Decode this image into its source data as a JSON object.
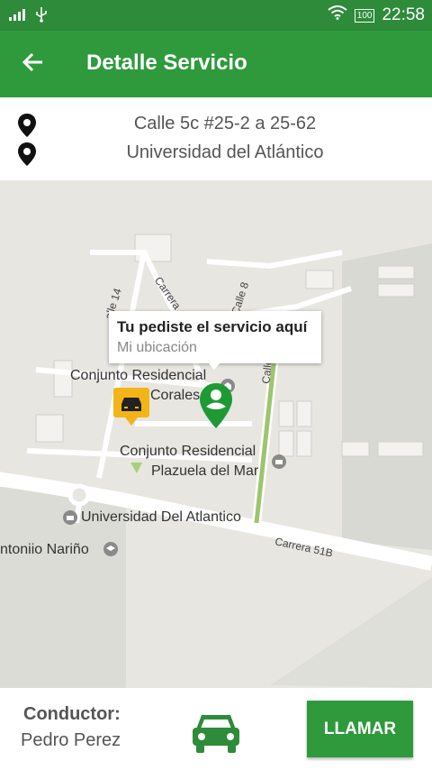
{
  "status_bar": {
    "battery": "100",
    "time": "22:58"
  },
  "app_bar": {
    "title": "Detalle Servicio"
  },
  "route": {
    "origin": "Calle 5c #25-2 a 25-62",
    "destination": "Universidad del Atlántico"
  },
  "map": {
    "info_window": {
      "title": "Tu pediste el servicio aquí",
      "subtitle": "Mi ubicación"
    },
    "labels": {
      "conjunto_corales_1": "Conjunto Residencial",
      "conjunto_corales_2": "Corales",
      "conjunto_plazuela_1": "Conjunto Residencial",
      "conjunto_plazuela_2": "Plazuela del Mar",
      "universidad": "Universidad Del Atlantico",
      "antonio": "ntoniio Nariño",
      "street_carrera_51b": "Carrera 51B",
      "street_calle_14": "alle 14",
      "street_carrera": "Carrera",
      "street_calle_8": "Calle 8",
      "street_calle": "Calle"
    }
  },
  "driver": {
    "label": "Conductor:",
    "name": "Pedro Perez"
  },
  "call_button": {
    "label": "LLAMAR"
  }
}
